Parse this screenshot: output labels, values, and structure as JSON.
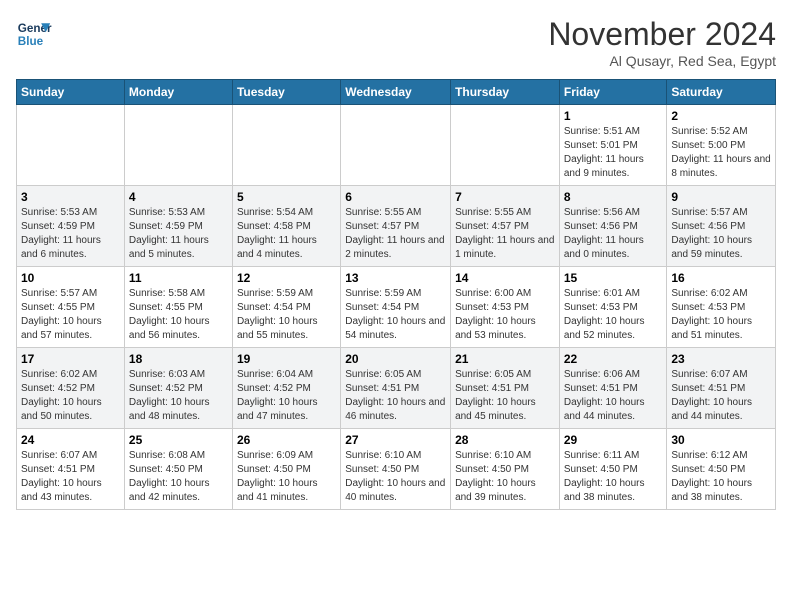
{
  "logo": {
    "line1": "General",
    "line2": "Blue"
  },
  "title": "November 2024",
  "subtitle": "Al Qusayr, Red Sea, Egypt",
  "days_of_week": [
    "Sunday",
    "Monday",
    "Tuesday",
    "Wednesday",
    "Thursday",
    "Friday",
    "Saturday"
  ],
  "weeks": [
    [
      {
        "day": "",
        "info": ""
      },
      {
        "day": "",
        "info": ""
      },
      {
        "day": "",
        "info": ""
      },
      {
        "day": "",
        "info": ""
      },
      {
        "day": "",
        "info": ""
      },
      {
        "day": "1",
        "info": "Sunrise: 5:51 AM\nSunset: 5:01 PM\nDaylight: 11 hours and 9 minutes."
      },
      {
        "day": "2",
        "info": "Sunrise: 5:52 AM\nSunset: 5:00 PM\nDaylight: 11 hours and 8 minutes."
      }
    ],
    [
      {
        "day": "3",
        "info": "Sunrise: 5:53 AM\nSunset: 4:59 PM\nDaylight: 11 hours and 6 minutes."
      },
      {
        "day": "4",
        "info": "Sunrise: 5:53 AM\nSunset: 4:59 PM\nDaylight: 11 hours and 5 minutes."
      },
      {
        "day": "5",
        "info": "Sunrise: 5:54 AM\nSunset: 4:58 PM\nDaylight: 11 hours and 4 minutes."
      },
      {
        "day": "6",
        "info": "Sunrise: 5:55 AM\nSunset: 4:57 PM\nDaylight: 11 hours and 2 minutes."
      },
      {
        "day": "7",
        "info": "Sunrise: 5:55 AM\nSunset: 4:57 PM\nDaylight: 11 hours and 1 minute."
      },
      {
        "day": "8",
        "info": "Sunrise: 5:56 AM\nSunset: 4:56 PM\nDaylight: 11 hours and 0 minutes."
      },
      {
        "day": "9",
        "info": "Sunrise: 5:57 AM\nSunset: 4:56 PM\nDaylight: 10 hours and 59 minutes."
      }
    ],
    [
      {
        "day": "10",
        "info": "Sunrise: 5:57 AM\nSunset: 4:55 PM\nDaylight: 10 hours and 57 minutes."
      },
      {
        "day": "11",
        "info": "Sunrise: 5:58 AM\nSunset: 4:55 PM\nDaylight: 10 hours and 56 minutes."
      },
      {
        "day": "12",
        "info": "Sunrise: 5:59 AM\nSunset: 4:54 PM\nDaylight: 10 hours and 55 minutes."
      },
      {
        "day": "13",
        "info": "Sunrise: 5:59 AM\nSunset: 4:54 PM\nDaylight: 10 hours and 54 minutes."
      },
      {
        "day": "14",
        "info": "Sunrise: 6:00 AM\nSunset: 4:53 PM\nDaylight: 10 hours and 53 minutes."
      },
      {
        "day": "15",
        "info": "Sunrise: 6:01 AM\nSunset: 4:53 PM\nDaylight: 10 hours and 52 minutes."
      },
      {
        "day": "16",
        "info": "Sunrise: 6:02 AM\nSunset: 4:53 PM\nDaylight: 10 hours and 51 minutes."
      }
    ],
    [
      {
        "day": "17",
        "info": "Sunrise: 6:02 AM\nSunset: 4:52 PM\nDaylight: 10 hours and 50 minutes."
      },
      {
        "day": "18",
        "info": "Sunrise: 6:03 AM\nSunset: 4:52 PM\nDaylight: 10 hours and 48 minutes."
      },
      {
        "day": "19",
        "info": "Sunrise: 6:04 AM\nSunset: 4:52 PM\nDaylight: 10 hours and 47 minutes."
      },
      {
        "day": "20",
        "info": "Sunrise: 6:05 AM\nSunset: 4:51 PM\nDaylight: 10 hours and 46 minutes."
      },
      {
        "day": "21",
        "info": "Sunrise: 6:05 AM\nSunset: 4:51 PM\nDaylight: 10 hours and 45 minutes."
      },
      {
        "day": "22",
        "info": "Sunrise: 6:06 AM\nSunset: 4:51 PM\nDaylight: 10 hours and 44 minutes."
      },
      {
        "day": "23",
        "info": "Sunrise: 6:07 AM\nSunset: 4:51 PM\nDaylight: 10 hours and 44 minutes."
      }
    ],
    [
      {
        "day": "24",
        "info": "Sunrise: 6:07 AM\nSunset: 4:51 PM\nDaylight: 10 hours and 43 minutes."
      },
      {
        "day": "25",
        "info": "Sunrise: 6:08 AM\nSunset: 4:50 PM\nDaylight: 10 hours and 42 minutes."
      },
      {
        "day": "26",
        "info": "Sunrise: 6:09 AM\nSunset: 4:50 PM\nDaylight: 10 hours and 41 minutes."
      },
      {
        "day": "27",
        "info": "Sunrise: 6:10 AM\nSunset: 4:50 PM\nDaylight: 10 hours and 40 minutes."
      },
      {
        "day": "28",
        "info": "Sunrise: 6:10 AM\nSunset: 4:50 PM\nDaylight: 10 hours and 39 minutes."
      },
      {
        "day": "29",
        "info": "Sunrise: 6:11 AM\nSunset: 4:50 PM\nDaylight: 10 hours and 38 minutes."
      },
      {
        "day": "30",
        "info": "Sunrise: 6:12 AM\nSunset: 4:50 PM\nDaylight: 10 hours and 38 minutes."
      }
    ]
  ]
}
